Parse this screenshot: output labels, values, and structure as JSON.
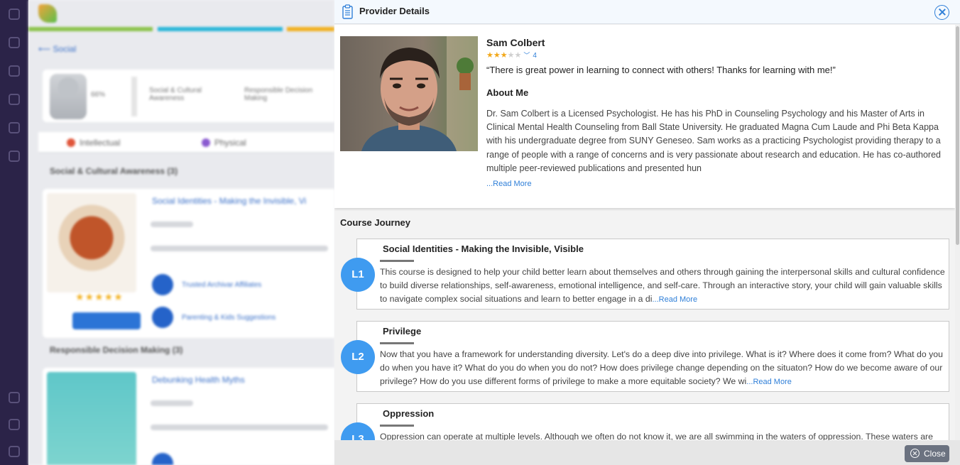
{
  "modal": {
    "title": "Provider Details",
    "close_label": "Close"
  },
  "provider": {
    "name": "Sam Colbert",
    "rating": 3,
    "rating_max": 5,
    "rating_count": "4",
    "quote": "“There is great power in learning to connect with others! Thanks for learning with me!”",
    "about_title": "About Me",
    "about_text": "Dr. Sam Colbert is a Licensed Psychologist. He has his PhD in Counseling Psychology and his Master of Arts in Clinical Mental Health Counseling from Ball State University. He graduated Magna Cum Laude and Phi Beta Kappa with his undergraduate degree from SUNY Geneseo. Sam works as a practicing Psychologist providing therapy to a range of people with a range of concerns and is very passionate about research and education. He has co-authored multiple peer-reviewed publications and presented hun",
    "read_more": "...Read More"
  },
  "journey": {
    "title": "Course Journey",
    "lessons": [
      {
        "badge": "L1",
        "title": "Social Identities - Making the Invisible, Visible",
        "description": "This course is designed to help your child better learn about themselves and others through gaining the interpersonal skills and cultural confidence to build diverse relationships, self-awareness, emotional intelligence, and self-care. Through an interactive story, your child will gain valuable skills to navigate complex social situations and learn to better engage in a di",
        "read_more": "...Read More"
      },
      {
        "badge": "L2",
        "title": "Privilege",
        "description": "Now that you have a framework for understanding diversity. Let's do a deep dive into privilege. What is it? Where does it come from? What do you do when you have it? What do you do when you do not? How does privilege change depending on the situaton? How do we become aware of our privilege? How do you use different forms of privilege to make a more equitable society? We wi",
        "read_more": "...Read More"
      },
      {
        "badge": "L3",
        "title": "Oppression",
        "description": "Oppression can operate at multiple levels. Although we often do not know it, we are all swimming in the waters of oppression. These waters are",
        "read_more": ""
      }
    ]
  },
  "background": {
    "back_link": "Social",
    "stat_percent": "66%",
    "stat_1": "Social & Cultural Awareness",
    "stat_2": "Responsible Decision Making",
    "tab_intellectual": "Intellectual",
    "tab_physical": "Physical",
    "section_1": "Social & Cultural Awareness (3)",
    "section_2": "Responsible Decision Making (3)",
    "course_1_title": "Social Identities - Making the Invisible, Vi",
    "course_2_title": "Debunking Health Myths",
    "grade": "Grade 4",
    "enroll": "Enroll",
    "provider_link_1": "Trusted Archivar Affiliates",
    "provider_link_2": "Parenting & Kids Suggestions"
  },
  "colors": {
    "accent": "#2f7fd8",
    "badge": "#3f9bf0",
    "star": "#f2a81a",
    "rail": "#2b2348"
  }
}
